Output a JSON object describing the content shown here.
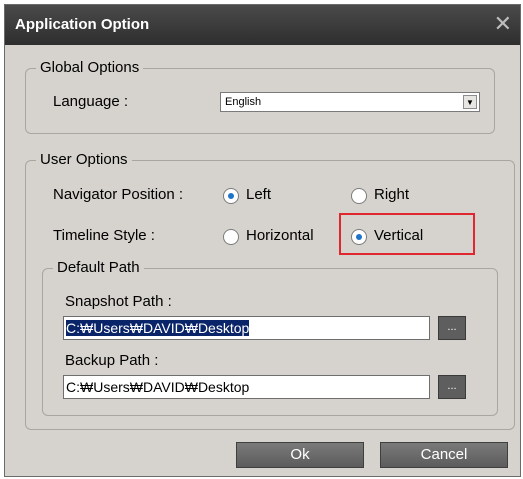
{
  "window": {
    "title": "Application Option",
    "close_glyph": "✕"
  },
  "global_options": {
    "legend": "Global Options",
    "language_label": "Language :",
    "language_value": "English",
    "dropdown_glyph": "▼"
  },
  "user_options": {
    "legend": "User Options",
    "navigator_label": "Navigator Position :",
    "navigator_options": [
      "Left",
      "Right"
    ],
    "navigator_selected": "Left",
    "timeline_label": "Timeline Style :",
    "timeline_options": [
      "Horizontal",
      "Vertical"
    ],
    "timeline_selected": "Vertical",
    "highlight_color": "#e0262e"
  },
  "default_path": {
    "legend": "Default Path",
    "snapshot_label": "Snapshot Path :",
    "snapshot_value": "C:₩Users₩DAVID₩Desktop",
    "backup_label": "Backup Path :",
    "backup_value": "C:₩Users₩DAVID₩Desktop",
    "browse_label": "..."
  },
  "buttons": {
    "ok": "Ok",
    "cancel": "Cancel"
  },
  "colors": {
    "titlebar": "#3a3a3a",
    "dialog_bg": "#d6d3ce",
    "radio_dot": "#1f74c9",
    "selection": "#0a246a"
  }
}
